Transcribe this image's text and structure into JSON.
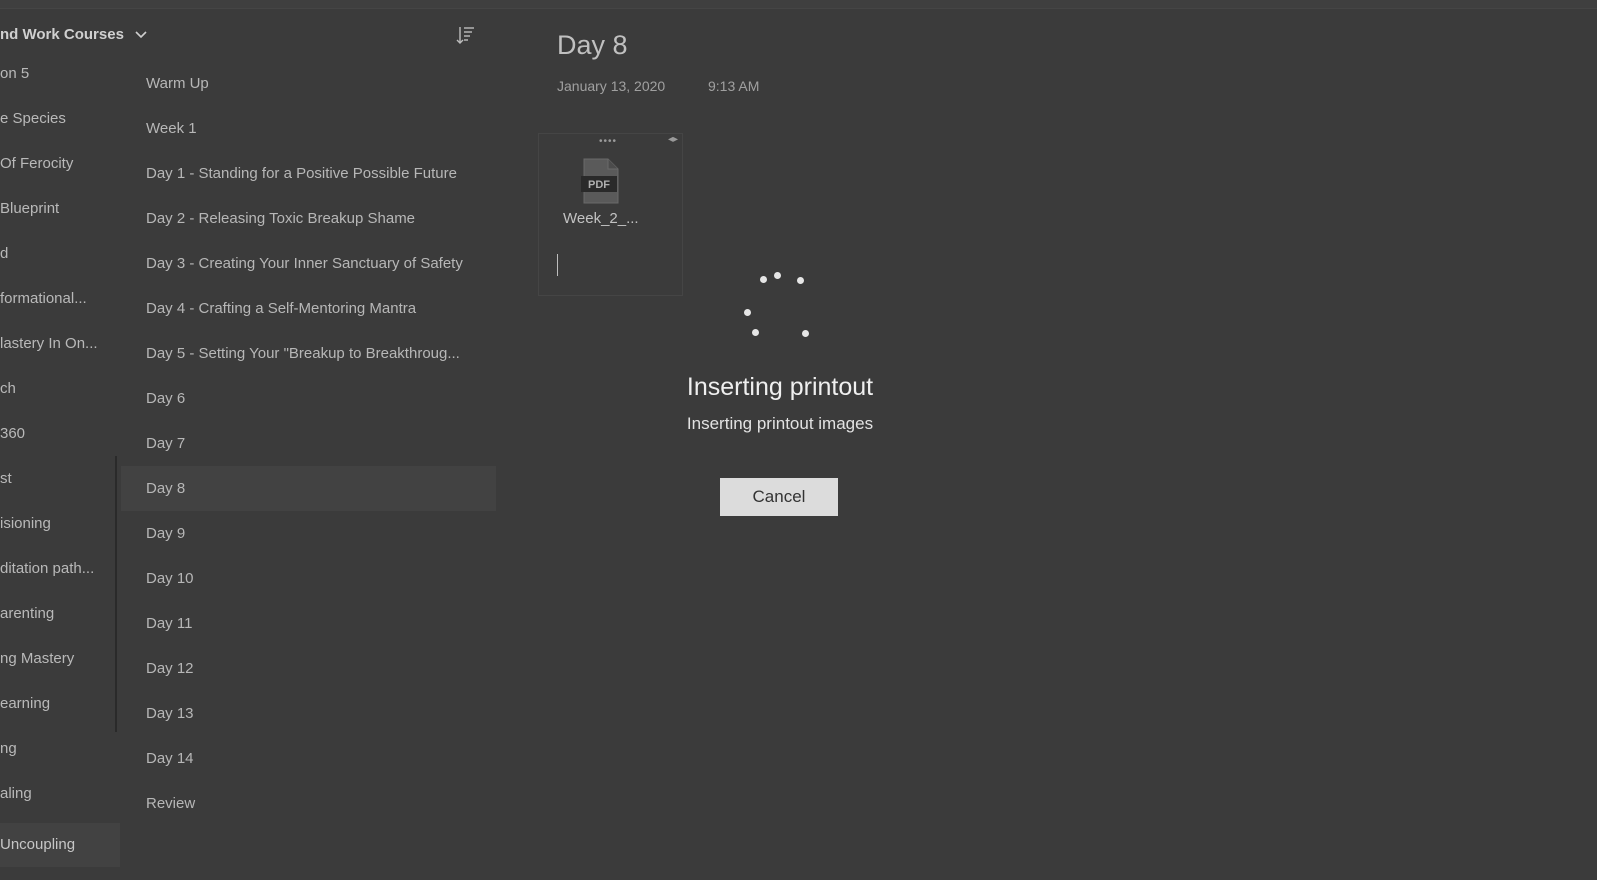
{
  "notebook": {
    "title": "nd Work Courses",
    "sections": [
      {
        "label": "on 5"
      },
      {
        "label": "e Species"
      },
      {
        "label": "Of Ferocity"
      },
      {
        "label": "Blueprint"
      },
      {
        "label": "d"
      },
      {
        "label": "formational..."
      },
      {
        "label": "lastery In On..."
      },
      {
        "label": "ch"
      },
      {
        "label": "360"
      },
      {
        "label": "st"
      },
      {
        "label": "isioning"
      },
      {
        "label": "ditation path..."
      },
      {
        "label": "arenting"
      },
      {
        "label": "ng Mastery"
      },
      {
        "label": "earning"
      },
      {
        "label": "ng"
      },
      {
        "label": "aling"
      },
      {
        "label": "Uncoupling",
        "selected": true
      }
    ]
  },
  "pages": [
    {
      "label": "Warm Up"
    },
    {
      "label": "Week 1"
    },
    {
      "label": "Day 1 - Standing for a Positive Possible Future"
    },
    {
      "label": "Day 2 - Releasing Toxic Breakup Shame"
    },
    {
      "label": "Day 3 - Creating Your Inner Sanctuary of Safety"
    },
    {
      "label": "Day 4 - Crafting a Self-Mentoring Mantra"
    },
    {
      "label": "Day 5 - Setting Your \"Breakup to Breakthroug..."
    },
    {
      "label": "Day 6"
    },
    {
      "label": "Day 7"
    },
    {
      "label": "Day 8",
      "selected": true
    },
    {
      "label": "Day 9"
    },
    {
      "label": "Day 10"
    },
    {
      "label": "Day 11"
    },
    {
      "label": "Day 12"
    },
    {
      "label": "Day 13"
    },
    {
      "label": "Day 14"
    },
    {
      "label": "Review"
    }
  ],
  "page": {
    "title": "Day 8",
    "date": "January 13, 2020",
    "time": "9:13 AM",
    "attachment": {
      "icon": "pdf-file-icon",
      "icon_text": "PDF",
      "name": "Week_2_..."
    }
  },
  "dialog": {
    "title": "Inserting printout",
    "subtitle": "Inserting printout images",
    "cancel_label": "Cancel"
  },
  "colors": {
    "overlay_bg": "#3b3b3b",
    "button_bg": "#dcdcdc"
  }
}
